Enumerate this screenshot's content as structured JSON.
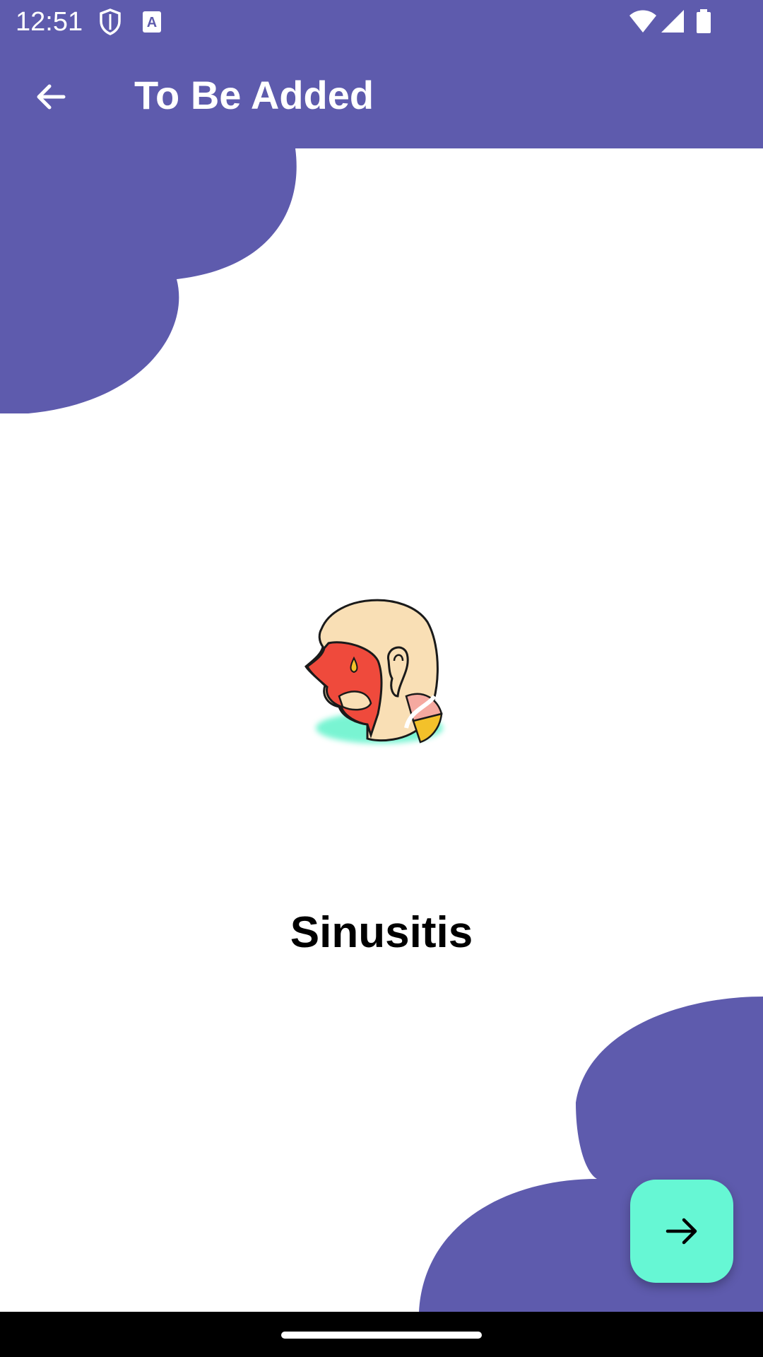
{
  "status_bar": {
    "time": "12:51",
    "icons": [
      "shield-icon",
      "font-a-icon",
      "wifi-icon",
      "signal-icon",
      "battery-icon"
    ]
  },
  "app_bar": {
    "title": "To Be Added",
    "back_icon": "arrow-left-icon"
  },
  "content": {
    "disease_name": "Sinusitis",
    "illustration": "sinusitis-head-illustration"
  },
  "fab": {
    "icon": "arrow-right-icon"
  },
  "colors": {
    "primary": "#5e5bad",
    "accent": "#66f7d4",
    "background": "#ffffff"
  }
}
